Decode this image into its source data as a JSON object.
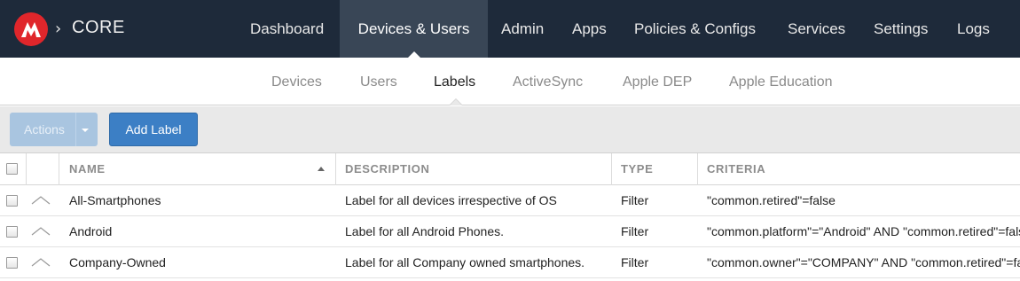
{
  "header": {
    "app_name": "CORE",
    "breadcrumb_separator": "›",
    "nav": [
      {
        "label": "Dashboard",
        "active": false
      },
      {
        "label": "Devices & Users",
        "active": true
      },
      {
        "label": "Admin",
        "active": false
      },
      {
        "label": "Apps",
        "active": false
      },
      {
        "label": "Policies & Configs",
        "active": false
      },
      {
        "label": "Services",
        "active": false
      },
      {
        "label": "Settings",
        "active": false
      },
      {
        "label": "Logs",
        "active": false
      }
    ]
  },
  "subnav": {
    "items": [
      {
        "label": "Devices",
        "active": false
      },
      {
        "label": "Users",
        "active": false
      },
      {
        "label": "Labels",
        "active": true
      },
      {
        "label": "ActiveSync",
        "active": false
      },
      {
        "label": "Apple DEP",
        "active": false
      },
      {
        "label": "Apple Education",
        "active": false
      }
    ]
  },
  "toolbar": {
    "actions_label": "Actions",
    "add_label": "Add Label"
  },
  "table": {
    "columns": [
      "NAME",
      "DESCRIPTION",
      "TYPE",
      "CRITERIA"
    ],
    "sort": {
      "column": "NAME",
      "direction": "ascending"
    },
    "rows": [
      {
        "name": "All-Smartphones",
        "description": "Label for all devices irrespective of OS",
        "type": "Filter",
        "criteria": "\"common.retired\"=false"
      },
      {
        "name": "Android",
        "description": "Label for all Android Phones.",
        "type": "Filter",
        "criteria": "\"common.platform\"=\"Android\" AND \"common.retired\"=false"
      },
      {
        "name": "Company-Owned",
        "description": "Label for all Company owned smartphones.",
        "type": "Filter",
        "criteria": "\"common.owner\"=\"COMPANY\" AND \"common.retired\"=false"
      }
    ]
  },
  "colors": {
    "nav_bg": "#1e2a3a",
    "nav_active_bg": "#394656",
    "logo_red": "#e0262b",
    "primary_button": "#3c7fc5",
    "disabled_button": "#a9c5e0"
  }
}
